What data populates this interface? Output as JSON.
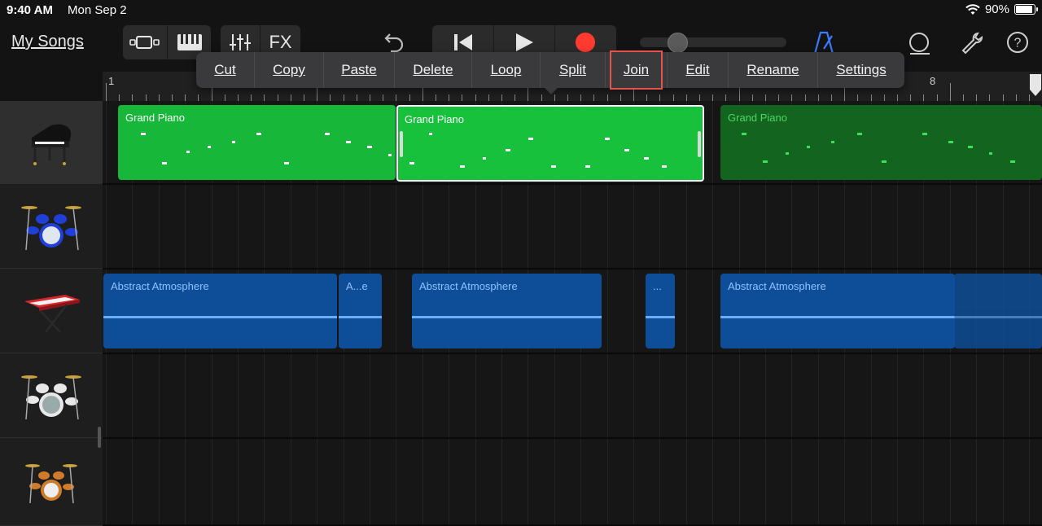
{
  "status": {
    "time": "9:40 AM",
    "date": "Mon Sep 2",
    "battery": "90%",
    "battery_level": 0.9
  },
  "toolbar": {
    "my_songs": "My Songs",
    "fx": "FX",
    "icons": [
      "browser-view-icon",
      "keyboard-icon",
      "mixer-icon",
      "undo-icon",
      "rewind-icon",
      "play-icon",
      "record-icon",
      "metronome-icon",
      "loop-browser-icon",
      "settings-wrench-icon",
      "help-icon"
    ],
    "volume_level": 0.27,
    "accent": "#ff3b30"
  },
  "menu": {
    "items": [
      "Cut",
      "Copy",
      "Paste",
      "Delete",
      "Loop",
      "Split",
      "Join",
      "Edit",
      "Rename",
      "Settings"
    ],
    "highlighted": "Join"
  },
  "ruler": {
    "bar_start": "1",
    "bar_end": "8"
  },
  "tracks": [
    {
      "instrument": "grand-piano",
      "regions": [
        "Grand Piano",
        "Grand Piano",
        "Grand Piano"
      ]
    },
    {
      "instrument": "drum-kit-blue",
      "regions": []
    },
    {
      "instrument": "synth-keyboard",
      "regions": [
        "Abstract Atmosphere",
        "A...e",
        "Abstract Atmosphere",
        "...",
        "Abstract Atmosphere"
      ]
    },
    {
      "instrument": "drum-kit-white",
      "regions": []
    },
    {
      "instrument": "drum-kit-orange",
      "regions": []
    }
  ],
  "colors": {
    "midi": "#17b83a",
    "midi_dim": "#13641f",
    "audio": "#0e4d97",
    "highlight": "#e5534b"
  }
}
